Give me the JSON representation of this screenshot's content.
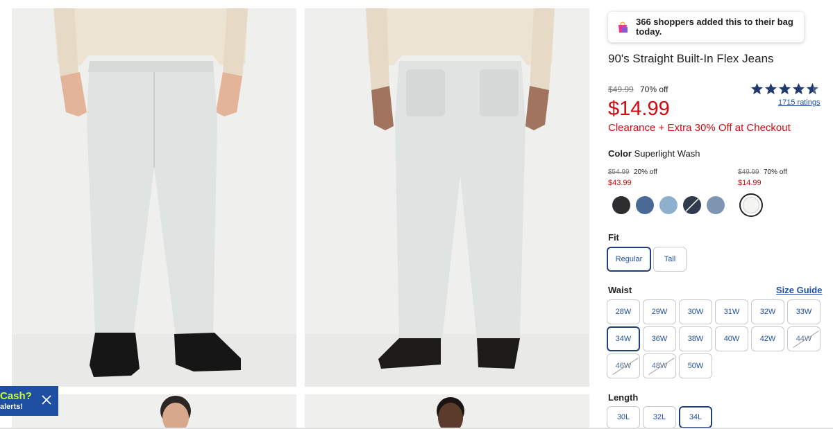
{
  "promo": {
    "line1": "Cash?",
    "line2": "alerts!",
    "close_icon": "close-icon"
  },
  "gallery": {
    "images": [
      {
        "name": "front-view-photo",
        "icon": "product-photo"
      },
      {
        "name": "back-view-photo",
        "icon": "product-photo"
      },
      {
        "name": "model-photo-3",
        "icon": "product-photo"
      },
      {
        "name": "model-photo-4",
        "icon": "product-photo"
      }
    ]
  },
  "product": {
    "shoppers_notice": "366 shoppers added this to their bag today.",
    "shoppers_icon": "shopping-bag-icon",
    "title": "90's Straight Built-In Flex Jeans",
    "original_price": "$49.99",
    "percent_off": "70% off",
    "sale_price": "$14.99",
    "promo_text": "Clearance + Extra 30% Off at Checkout",
    "rating": {
      "stars": 4.5,
      "max": 5,
      "count_label": "1715 ratings"
    },
    "colors": {
      "accent_blue": "#1f4fa3",
      "sale_red": "#d10a11"
    }
  },
  "color": {
    "label": "Color",
    "selected_name": "Superlight Wash",
    "groups": [
      {
        "original": "$54.99",
        "percent": "20% off",
        "sale": "$43.99"
      },
      {
        "original": "$49.99",
        "percent": "70% off",
        "sale": "$14.99"
      }
    ],
    "swatches": [
      {
        "name": "black wash",
        "color": "#2d2d2f",
        "available": true,
        "selected": false
      },
      {
        "name": "medium wash",
        "color": "#4a6a95",
        "available": true,
        "selected": false
      },
      {
        "name": "light wash",
        "color": "#8fb0cc",
        "available": true,
        "selected": false
      },
      {
        "name": "dark wash",
        "color": "#2f3a4c",
        "available": false,
        "selected": false
      },
      {
        "name": "light medium wash",
        "color": "#7e95b1",
        "available": true,
        "selected": false
      },
      {
        "name": "superlight wash",
        "color": "#f4f4f2",
        "available": true,
        "selected": true
      }
    ]
  },
  "fit": {
    "label": "Fit",
    "options": [
      "Regular",
      "Tall"
    ],
    "selected": "Regular"
  },
  "waist": {
    "label": "Waist",
    "size_guide": "Size Guide",
    "options": [
      "28W",
      "29W",
      "30W",
      "31W",
      "32W",
      "33W",
      "34W",
      "36W",
      "38W",
      "40W",
      "42W",
      "44W",
      "46W",
      "48W",
      "50W"
    ],
    "unavailable": [
      "44W",
      "46W",
      "48W"
    ],
    "selected": "34W"
  },
  "length": {
    "label": "Length",
    "options": [
      "30L",
      "32L",
      "34L"
    ],
    "selected": "34L"
  }
}
